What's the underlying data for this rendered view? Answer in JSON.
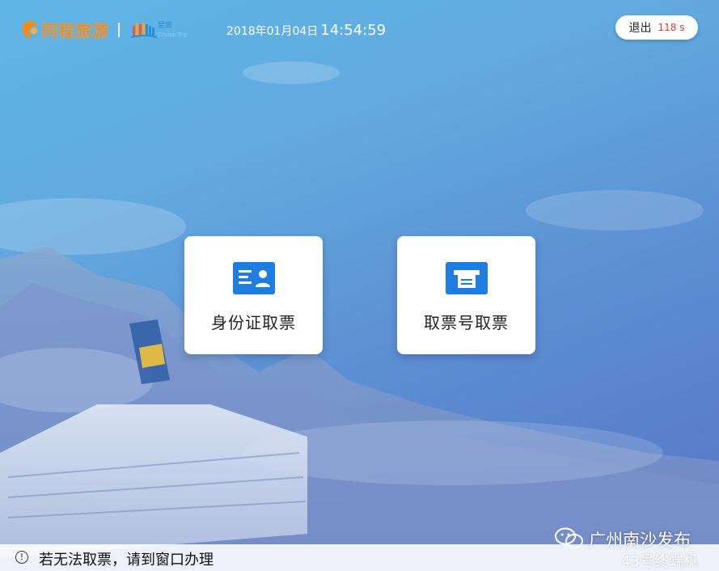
{
  "header": {
    "brand_name": "同程旅游",
    "partner_logo_text": "星旅",
    "partner_logo_sub": "Cruise Trip",
    "date": "2018年01月04日",
    "time": "14:54:59"
  },
  "exit_button": {
    "label": "退出",
    "countdown": "118 s"
  },
  "options": [
    {
      "label": "身份证取票",
      "icon": "id-card-icon"
    },
    {
      "label": "取票号取票",
      "icon": "ticket-printer-icon"
    }
  ],
  "footer": {
    "notice_icon": "info-circle-icon",
    "notice_text": "若无法取票，请到窗口办理"
  },
  "watermark": {
    "account_name": "广州南沙发布",
    "terminal": "43号终端机",
    "icon": "wechat-icon"
  },
  "colors": {
    "brand_orange": "#f38b1c",
    "icon_blue": "#1c6fd6",
    "countdown_red": "#e33a2e"
  }
}
